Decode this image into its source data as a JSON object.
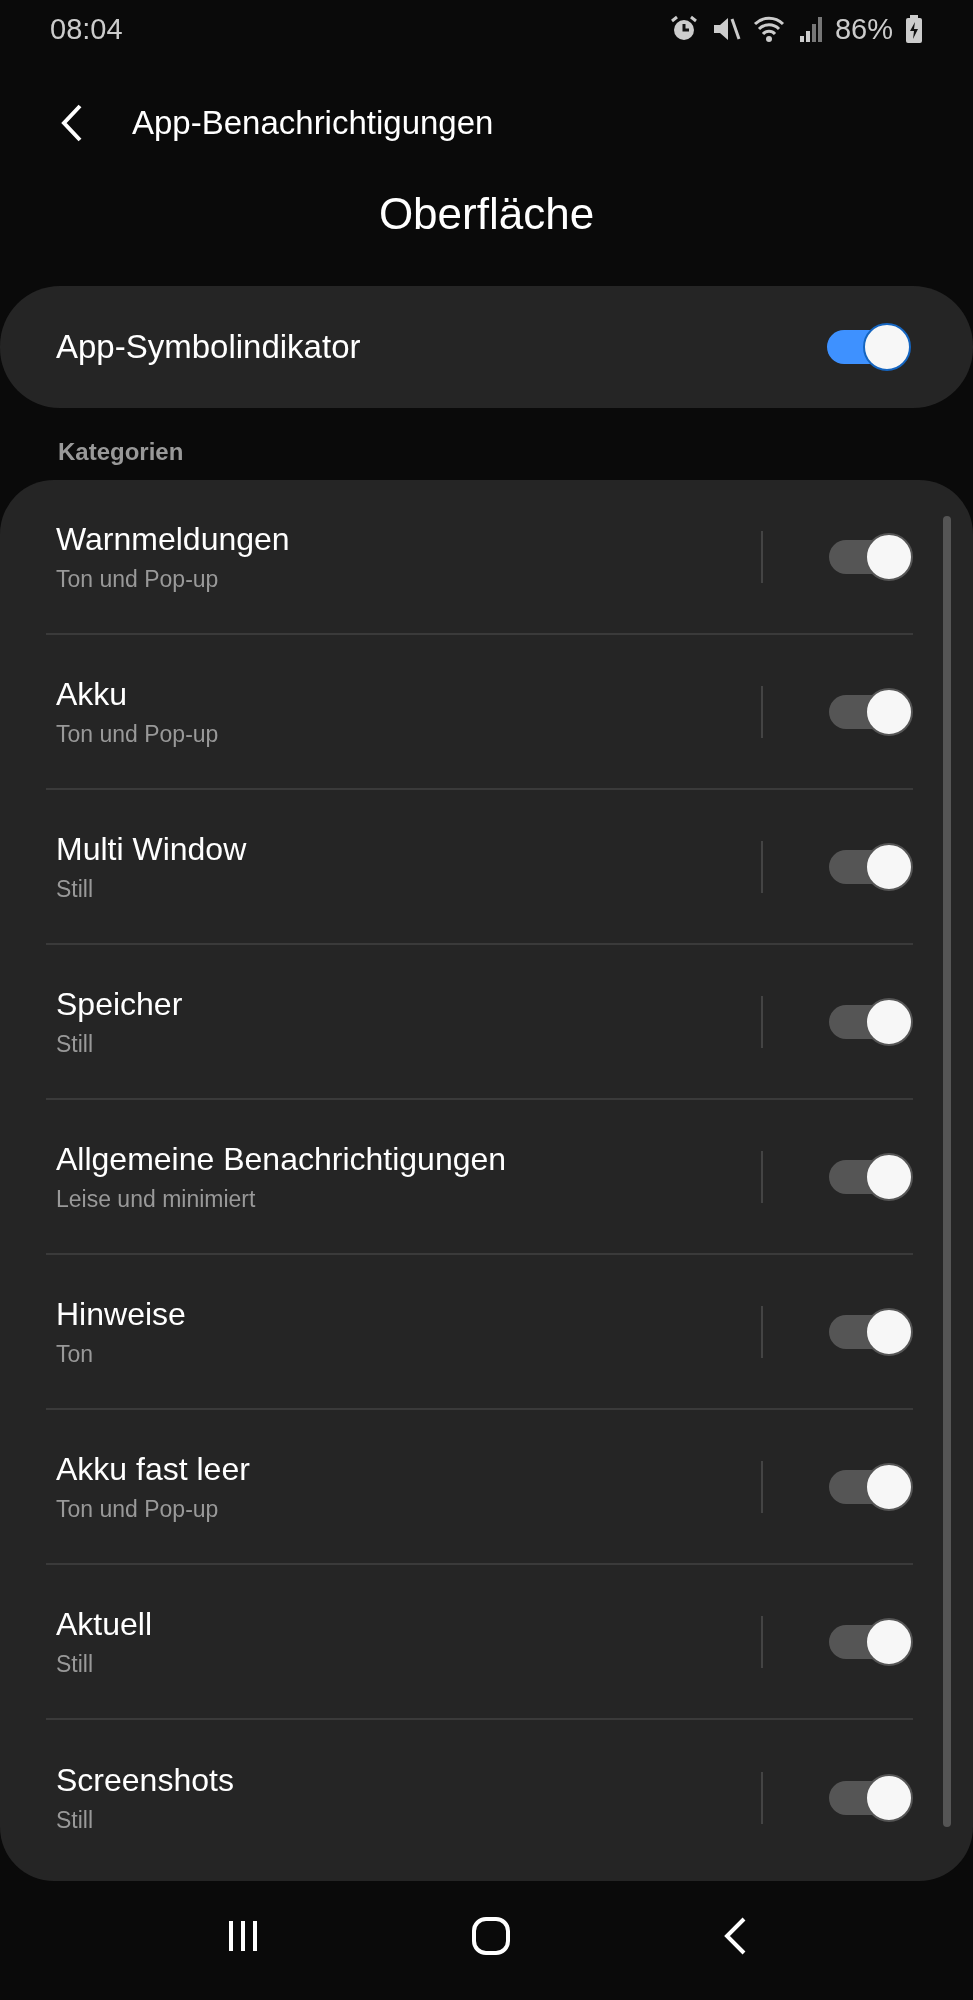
{
  "status_bar": {
    "time": "08:04",
    "battery": "86%"
  },
  "header": {
    "title": "App-Benachrichtigungen"
  },
  "section_title": "Oberfläche",
  "badge_setting": {
    "label": "App-Symbolindikator",
    "on": true,
    "disabled": false
  },
  "categories_label": "Kategorien",
  "categories": [
    {
      "name": "Warnmeldungen",
      "description": "Ton und Pop-up",
      "on": true,
      "disabled": true
    },
    {
      "name": "Akku",
      "description": "Ton und Pop-up",
      "on": true,
      "disabled": true
    },
    {
      "name": "Multi Window",
      "description": "Still",
      "on": true,
      "disabled": true
    },
    {
      "name": "Speicher",
      "description": "Still",
      "on": true,
      "disabled": true
    },
    {
      "name": "Allgemeine Benachrichtigungen",
      "description": "Leise und minimiert",
      "on": true,
      "disabled": true
    },
    {
      "name": "Hinweise",
      "description": "Ton",
      "on": true,
      "disabled": true
    },
    {
      "name": "Akku fast leer",
      "description": "Ton und Pop-up",
      "on": true,
      "disabled": true
    },
    {
      "name": "Aktuell",
      "description": "Still",
      "on": true,
      "disabled": true
    },
    {
      "name": "Screenshots",
      "description": "Still",
      "on": true,
      "disabled": true
    }
  ]
}
